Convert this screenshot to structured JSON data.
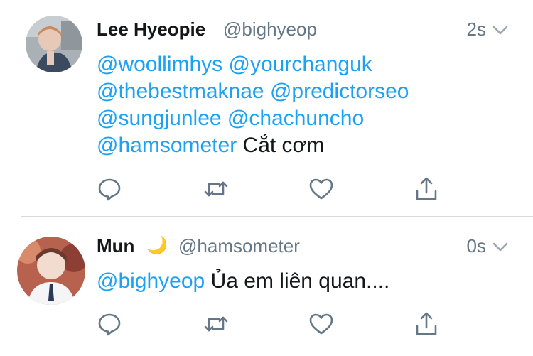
{
  "tweets": [
    {
      "name": "Lee Hyeopie",
      "handle": "@bighyeop",
      "time": "2s",
      "mentions": [
        "@woollimhys",
        "@yourchanguk",
        "@thebestmaknae",
        "@predictorseo",
        "@sungjunlee",
        "@chachuncho",
        "@hamsometer"
      ],
      "text": "Cắt cơm"
    },
    {
      "name": "Mun",
      "handle": "@hamsometer",
      "time": "0s",
      "mentions": [
        "@bighyeop"
      ],
      "text": "Ủa em liên quan...."
    }
  ],
  "icons": {
    "reply": "reply-icon",
    "retweet": "retweet-icon",
    "like": "heart-icon",
    "share": "share-icon",
    "menu": "chevron-down-icon"
  },
  "colors": {
    "mention": "#1da1f2",
    "meta": "#657786",
    "icon": "#657786"
  }
}
